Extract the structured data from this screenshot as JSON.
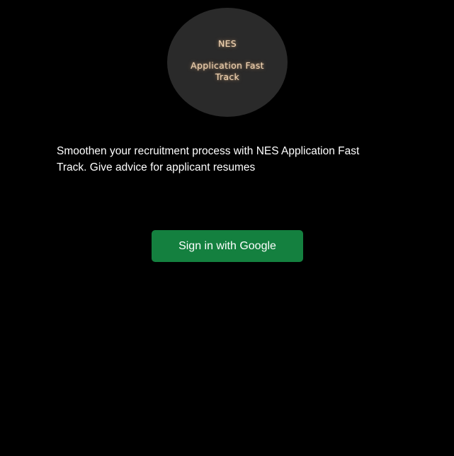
{
  "logo": {
    "name": "NES",
    "title": "Application Fast Track"
  },
  "main": {
    "tagline": "Smoothen your recruitment process with NES Application Fast Track. Give advice for applicant resumes",
    "signin_button_label": "Sign in with Google"
  },
  "colors": {
    "background": "#000000",
    "logo_circle": "#2a2a2a",
    "logo_text": "#f3d7b6",
    "button": "#14803f",
    "text": "#ffffff"
  }
}
